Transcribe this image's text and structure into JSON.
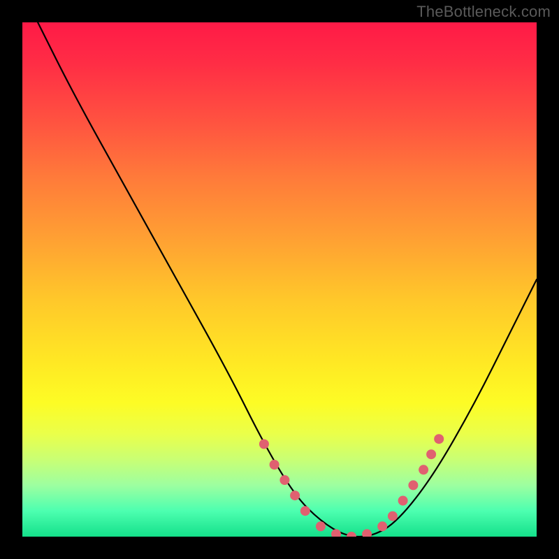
{
  "watermark": "TheBottleneck.com",
  "chart_data": {
    "type": "line",
    "title": "",
    "xlabel": "",
    "ylabel": "",
    "xlim": [
      0,
      100
    ],
    "ylim": [
      0,
      100
    ],
    "series": [
      {
        "name": "bottleneck-curve",
        "x": [
          3,
          10,
          20,
          30,
          40,
          47,
          53,
          58,
          63,
          68,
          73,
          80,
          88,
          95,
          100
        ],
        "y": [
          100,
          86,
          68,
          50,
          32,
          18,
          8,
          3,
          0,
          0,
          3,
          12,
          26,
          40,
          50
        ]
      }
    ],
    "markers": {
      "name": "highlight-dots",
      "color": "#e06070",
      "points": [
        {
          "x": 47,
          "y": 18
        },
        {
          "x": 49,
          "y": 14
        },
        {
          "x": 51,
          "y": 11
        },
        {
          "x": 53,
          "y": 8
        },
        {
          "x": 55,
          "y": 5
        },
        {
          "x": 58,
          "y": 2
        },
        {
          "x": 61,
          "y": 0.5
        },
        {
          "x": 64,
          "y": 0
        },
        {
          "x": 67,
          "y": 0.5
        },
        {
          "x": 70,
          "y": 2
        },
        {
          "x": 72,
          "y": 4
        },
        {
          "x": 74,
          "y": 7
        },
        {
          "x": 76,
          "y": 10
        },
        {
          "x": 78,
          "y": 13
        },
        {
          "x": 79.5,
          "y": 16
        },
        {
          "x": 81,
          "y": 19
        }
      ]
    },
    "gradient_stops": [
      {
        "pos": 0,
        "color": "#ff1a47"
      },
      {
        "pos": 50,
        "color": "#ffc82a"
      },
      {
        "pos": 80,
        "color": "#fdfc25"
      },
      {
        "pos": 100,
        "color": "#14e08a"
      }
    ]
  }
}
